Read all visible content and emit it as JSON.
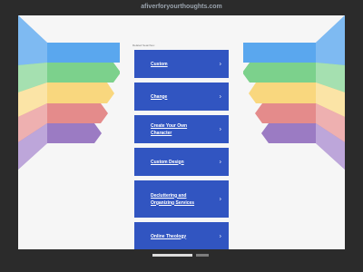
{
  "header": {
    "domain": "afiverforyourthoughts.com"
  },
  "main": {
    "related_label": "Related Searches:",
    "links": [
      {
        "label": "Custom"
      },
      {
        "label": "Change"
      },
      {
        "label": "Create Your Own Character"
      },
      {
        "label": "Custom Design"
      },
      {
        "label": "Decluttering and Organizing Services"
      },
      {
        "label": "Online Theology"
      }
    ],
    "chevron": "›"
  },
  "colors": {
    "page_bg": "#2b2b2b",
    "link_bg": "#3155c1",
    "ribbon_blue": "#5aa7ee",
    "ribbon_green": "#7cd18c",
    "ribbon_yellow": "#f9d77e",
    "ribbon_red": "#e48b8b",
    "ribbon_purple": "#9b7bc3"
  }
}
